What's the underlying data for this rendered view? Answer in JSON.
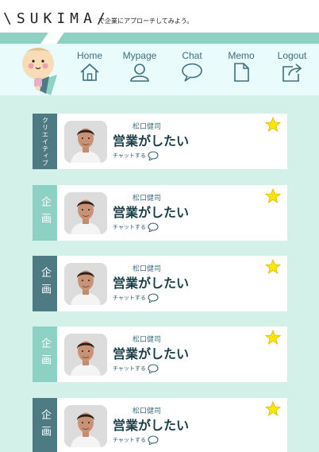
{
  "brand": {
    "logo": "\\SUKIMA/",
    "tagline": "で企業にアプローチしてみよう。"
  },
  "nav": {
    "items": [
      {
        "label": "Home",
        "icon": "home-icon"
      },
      {
        "label": "Mypage",
        "icon": "user-icon"
      },
      {
        "label": "Chat",
        "icon": "speech-bubble-icon"
      },
      {
        "label": "Memo",
        "icon": "document-icon"
      },
      {
        "label": "Logout",
        "icon": "logout-icon"
      }
    ]
  },
  "colors": {
    "background": "#d3f1e8",
    "teal": "#8dd0c4",
    "dark_teal": "#4e7a84",
    "nav_bg": "#e9fbfa",
    "star": "#ffe600"
  },
  "cards": [
    {
      "tag": "クリエイティブ",
      "tag_style": "creative",
      "name": "松口健司",
      "title": "営業がしたい",
      "chat_label": "チャットする",
      "starred": true
    },
    {
      "tag": "企画",
      "tag_style": "kikaku",
      "name": "松口健司",
      "title": "営業がしたい",
      "chat_label": "チャットする",
      "starred": true
    },
    {
      "tag": "企画",
      "tag_style": "kikaku-dark",
      "name": "松口健司",
      "title": "営業がしたい",
      "chat_label": "チャットする",
      "starred": true
    },
    {
      "tag": "企画",
      "tag_style": "kikaku",
      "name": "松口健司",
      "title": "営業がしたい",
      "chat_label": "チャットする",
      "starred": true
    },
    {
      "tag": "企画",
      "tag_style": "kikaku-dark",
      "name": "松口健司",
      "title": "営業がしたい",
      "chat_label": "チャットする",
      "starred": true
    }
  ]
}
